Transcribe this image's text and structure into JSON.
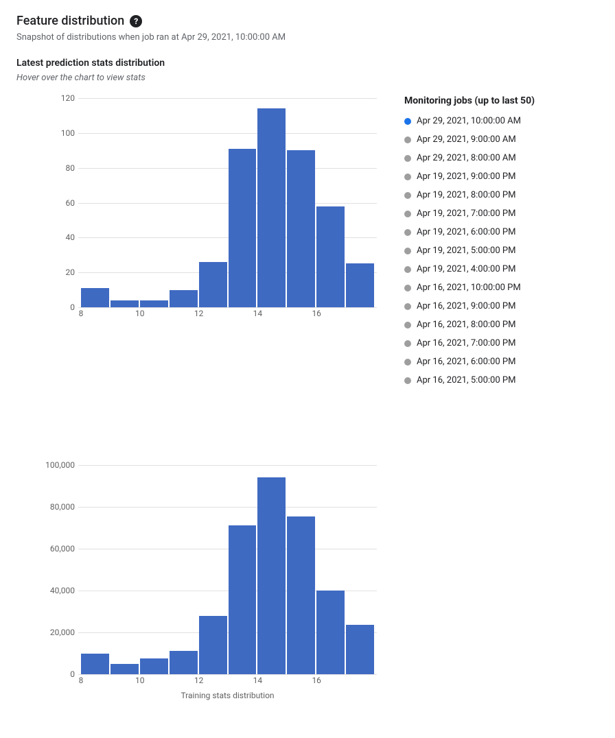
{
  "header": {
    "title": "Feature distribution",
    "help_icon": "?",
    "subtitle": "Snapshot of distributions when job ran at Apr 29, 2021, 10:00:00 AM"
  },
  "section": {
    "title": "Latest prediction stats distribution",
    "hint": "Hover over the chart to view stats"
  },
  "jobs": {
    "title": "Monitoring jobs (up to last 50)",
    "items": [
      {
        "label": "Apr 29, 2021, 10:00:00 AM",
        "active": true
      },
      {
        "label": "Apr 29, 2021, 9:00:00 AM",
        "active": false
      },
      {
        "label": "Apr 29, 2021, 8:00:00 AM",
        "active": false
      },
      {
        "label": "Apr 19, 2021, 9:00:00 PM",
        "active": false
      },
      {
        "label": "Apr 19, 2021, 8:00:00 PM",
        "active": false
      },
      {
        "label": "Apr 19, 2021, 7:00:00 PM",
        "active": false
      },
      {
        "label": "Apr 19, 2021, 6:00:00 PM",
        "active": false
      },
      {
        "label": "Apr 19, 2021, 5:00:00 PM",
        "active": false
      },
      {
        "label": "Apr 19, 2021, 4:00:00 PM",
        "active": false
      },
      {
        "label": "Apr 16, 2021, 10:00:00 PM",
        "active": false
      },
      {
        "label": "Apr 16, 2021, 9:00:00 PM",
        "active": false
      },
      {
        "label": "Apr 16, 2021, 8:00:00 PM",
        "active": false
      },
      {
        "label": "Apr 16, 2021, 7:00:00 PM",
        "active": false
      },
      {
        "label": "Apr 16, 2021, 6:00:00 PM",
        "active": false
      },
      {
        "label": "Apr 16, 2021, 5:00:00 PM",
        "active": false
      }
    ]
  },
  "colors": {
    "bar": "#3f6ac2",
    "dot_active": "#1a73e8",
    "dot_inactive": "#9e9e9e"
  },
  "chart_data": [
    {
      "type": "bar",
      "title": "Latest prediction stats distribution",
      "xlabel": "",
      "ylabel": "",
      "ylim": [
        0,
        120
      ],
      "yticks": [
        0,
        20,
        40,
        60,
        80,
        100,
        120
      ],
      "xticks": [
        8,
        10,
        12,
        14,
        16
      ],
      "x": [
        8,
        9,
        10,
        11,
        12,
        13,
        14,
        15,
        16,
        17
      ],
      "values": [
        11,
        4,
        4,
        10,
        26,
        91,
        114,
        90,
        58,
        25
      ]
    },
    {
      "type": "bar",
      "title": "Training stats distribution",
      "xlabel": "Training stats distribution",
      "ylabel": "",
      "ylim": [
        0,
        100000
      ],
      "yticks": [
        0,
        20000,
        40000,
        60000,
        80000,
        100000
      ],
      "ytick_labels": [
        "0",
        "20,000",
        "40,000",
        "60,000",
        "80,000",
        "100,000"
      ],
      "xticks": [
        8,
        10,
        12,
        14,
        16
      ],
      "x": [
        8,
        9,
        10,
        11,
        12,
        13,
        14,
        15,
        16,
        17
      ],
      "values": [
        10000,
        5000,
        7500,
        11000,
        28000,
        71000,
        94000,
        75500,
        40000,
        23500
      ]
    }
  ]
}
